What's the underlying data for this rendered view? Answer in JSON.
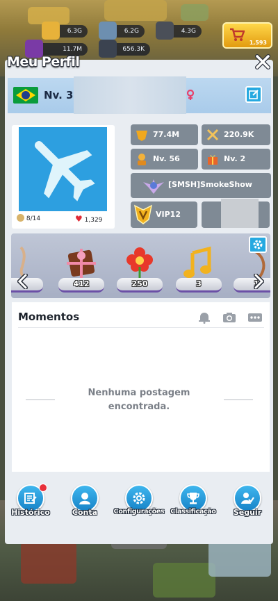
{
  "resources": {
    "gold": "6.3G",
    "metal": "6.2G",
    "oil": "4.3G",
    "gem_count": "11.7M",
    "power_count": "656.3K",
    "shop_price": "1,593"
  },
  "profile": {
    "title": "Meu Perfil",
    "level_label": "Nv. 30",
    "heads": "8/14",
    "likes": "1,329"
  },
  "stats": {
    "power": "77.4M",
    "kills": "220.9K",
    "commander_level": "Nv. 56",
    "gift_level": "Nv. 2",
    "alliance": "[SMSH]SmokeShow",
    "vip": "VIP12"
  },
  "collection": {
    "items": [
      {
        "name": "chocolate-gift",
        "count": "412"
      },
      {
        "name": "flower",
        "count": "250"
      },
      {
        "name": "music-note",
        "count": "3"
      },
      {
        "name": "partial-item",
        "count": "1"
      }
    ]
  },
  "moments": {
    "title": "Momentos",
    "empty_line1": "Nenhuma postagem",
    "empty_line2": "encontrada."
  },
  "nav": {
    "historico": "Histórico",
    "conta": "Conta",
    "configuracoes": "Configurações",
    "classificacao": "Classificação",
    "seguir": "Seguir"
  },
  "colors": {
    "accent_blue": "#26a9e0",
    "avatar_bg": "#2d9fe0",
    "chip_gray": "#7f8a95",
    "notification_red": "#e8303a"
  }
}
